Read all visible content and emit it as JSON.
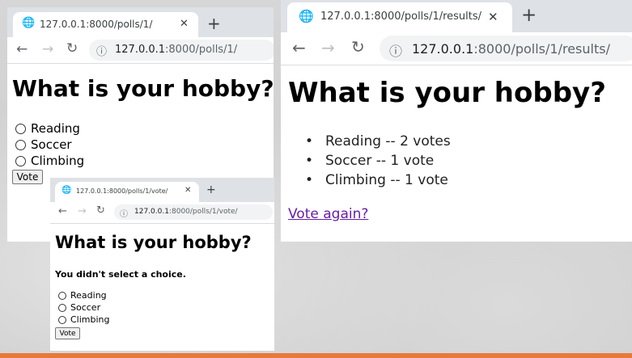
{
  "windows": {
    "polls": {
      "tab_title": "127.0.0.1:8000/polls/1/",
      "url_host": "127.0.0.1",
      "url_rest": ":8000/polls/1/",
      "heading": "What is your hobby?",
      "choices": [
        "Reading",
        "Soccer",
        "Climbing"
      ],
      "vote_button": "Vote"
    },
    "vote": {
      "tab_title": "127.0.0.1:8000/polls/1/vote/",
      "url_host": "127.0.0.1",
      "url_rest": ":8000/polls/1/vote/",
      "heading": "What is your hobby?",
      "error": "You didn't select a choice.",
      "choices": [
        "Reading",
        "Soccer",
        "Climbing"
      ],
      "vote_button": "Vote"
    },
    "results": {
      "tab_title": "127.0.0.1:8000/polls/1/results/",
      "url_host": "127.0.0.1",
      "url_rest": ":8000/polls/1/results/",
      "heading": "What is your hobby?",
      "results": [
        "Reading -- 2 votes",
        "Soccer -- 1 vote",
        "Climbing -- 1 vote"
      ],
      "link": "Vote again?"
    }
  },
  "glyphs": {
    "back": "←",
    "forward": "→",
    "reload": "↻",
    "close": "✕",
    "new_tab": "+",
    "info": "ⓘ",
    "globe": "🌐"
  },
  "colors": {
    "link_visited": "#681da8",
    "tab_strip": "#dee1e6",
    "accent_bar": "#e8793a"
  }
}
